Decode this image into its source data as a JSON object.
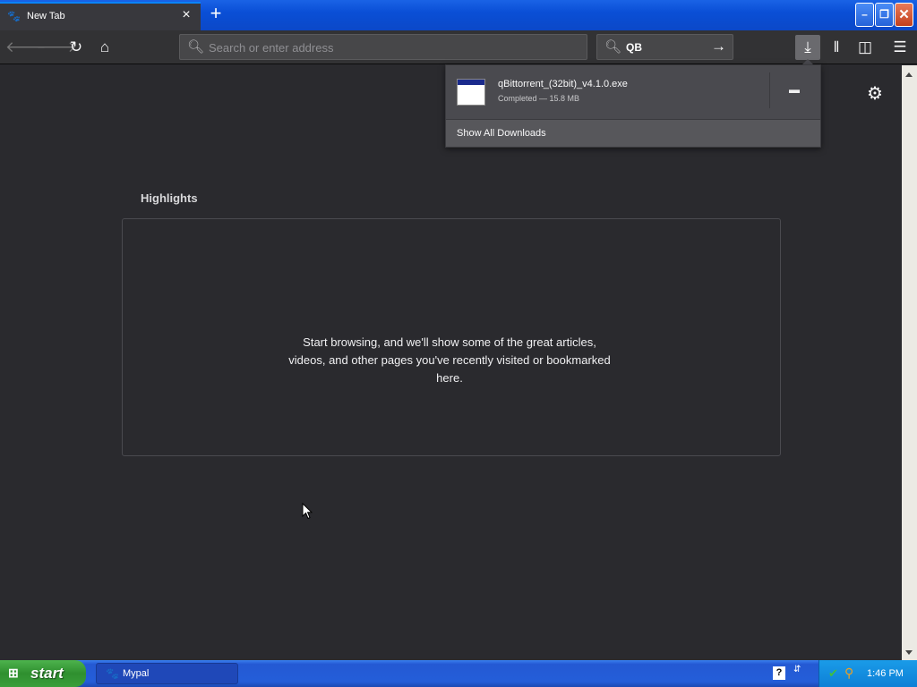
{
  "browser": {
    "tab": {
      "title": "New Tab"
    },
    "newtab_glyph": "+",
    "window_controls": {
      "minimize": "–",
      "restore": "❐",
      "close": "✕"
    },
    "address_bar": {
      "placeholder": "Search or enter address",
      "value": ""
    },
    "search_bar": {
      "value": "QB"
    }
  },
  "downloads_panel": {
    "item": {
      "filename": "qBittorrent_(32bit)_v4.1.0.exe",
      "status": "Completed — 15.8 MB"
    },
    "footer_label": "Show All Downloads"
  },
  "new_tab_page": {
    "highlights_title": "Highlights",
    "empty_message": "Start browsing, and we'll show some of the great articles, videos, and other pages you've recently visited or bookmarked here."
  },
  "taskbar": {
    "start_label": "start",
    "task_label": "Mypal",
    "clock": "1:46 PM"
  },
  "icons": [
    "back-icon",
    "forward-icon",
    "reload-icon",
    "home-icon",
    "search-icon",
    "arrow-right-icon",
    "download-icon",
    "library-icon",
    "sidebar-icon",
    "hamburger-menu-icon",
    "gear-icon",
    "folder-icon",
    "help-icon"
  ]
}
